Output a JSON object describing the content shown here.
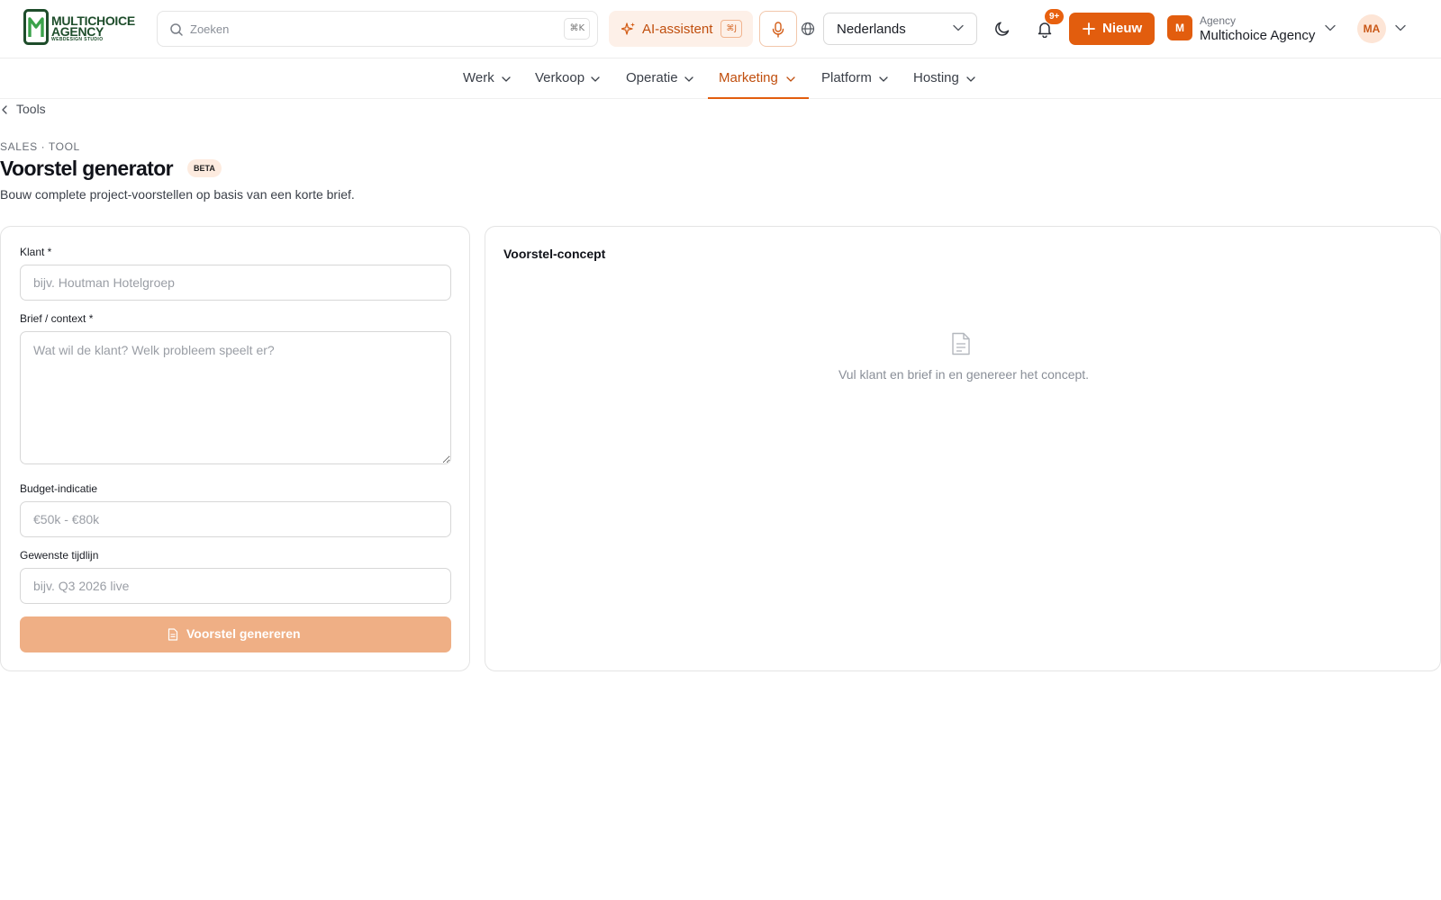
{
  "brand": {
    "line1": "MULTICHOICE",
    "line2": "AGENCY",
    "line3": "WEBDESIGN STUDIO"
  },
  "header": {
    "search_placeholder": "Zoeken",
    "search_kbd": "⌘K",
    "ai_label": "AI-assistent",
    "ai_kbd": "⌘J",
    "language": "Nederlands",
    "notification_badge": "9+",
    "new_label": "Nieuw",
    "agency_small": "Agency",
    "agency_name": "Multichoice Agency",
    "agency_initial": "M",
    "user_initials": "MA"
  },
  "nav": [
    {
      "label": "Werk",
      "active": false
    },
    {
      "label": "Verkoop",
      "active": false
    },
    {
      "label": "Operatie",
      "active": false
    },
    {
      "label": "Marketing",
      "active": true
    },
    {
      "label": "Platform",
      "active": false
    },
    {
      "label": "Hosting",
      "active": false
    }
  ],
  "page": {
    "breadcrumb": "Tools",
    "eyebrow": "SALES · TOOL",
    "title": "Voorstel generator",
    "badge": "BETA",
    "subtitle": "Bouw complete project-voorstellen op basis van een korte brief."
  },
  "form": {
    "client_label": "Klant *",
    "client_placeholder": "bijv. Houtman Hotelgroep",
    "client_value": "",
    "brief_label": "Brief / context *",
    "brief_placeholder": "Wat wil de klant? Welk probleem speelt er?",
    "brief_value": "",
    "budget_label": "Budget-indicatie",
    "budget_placeholder": "€50k - €80k",
    "budget_value": "",
    "timeline_label": "Gewenste tijdlijn",
    "timeline_placeholder": "bijv. Q3 2026 live",
    "timeline_value": "",
    "submit_label": "Voorstel genereren"
  },
  "preview": {
    "title": "Voorstel-concept",
    "empty_text": "Vul klant en brief in en genereer het concept."
  },
  "colors": {
    "accent": "#e25d0e",
    "accent_soft": "#fdf0e8",
    "button_disabled": "#efaf85"
  },
  "icons": {
    "search": "search-icon",
    "ai": "sparkles-icon",
    "mic": "microphone-icon",
    "globe": "globe-icon",
    "theme": "moon-icon",
    "notifications": "bell-icon",
    "new": "plus-icon",
    "empty": "document-icon"
  }
}
